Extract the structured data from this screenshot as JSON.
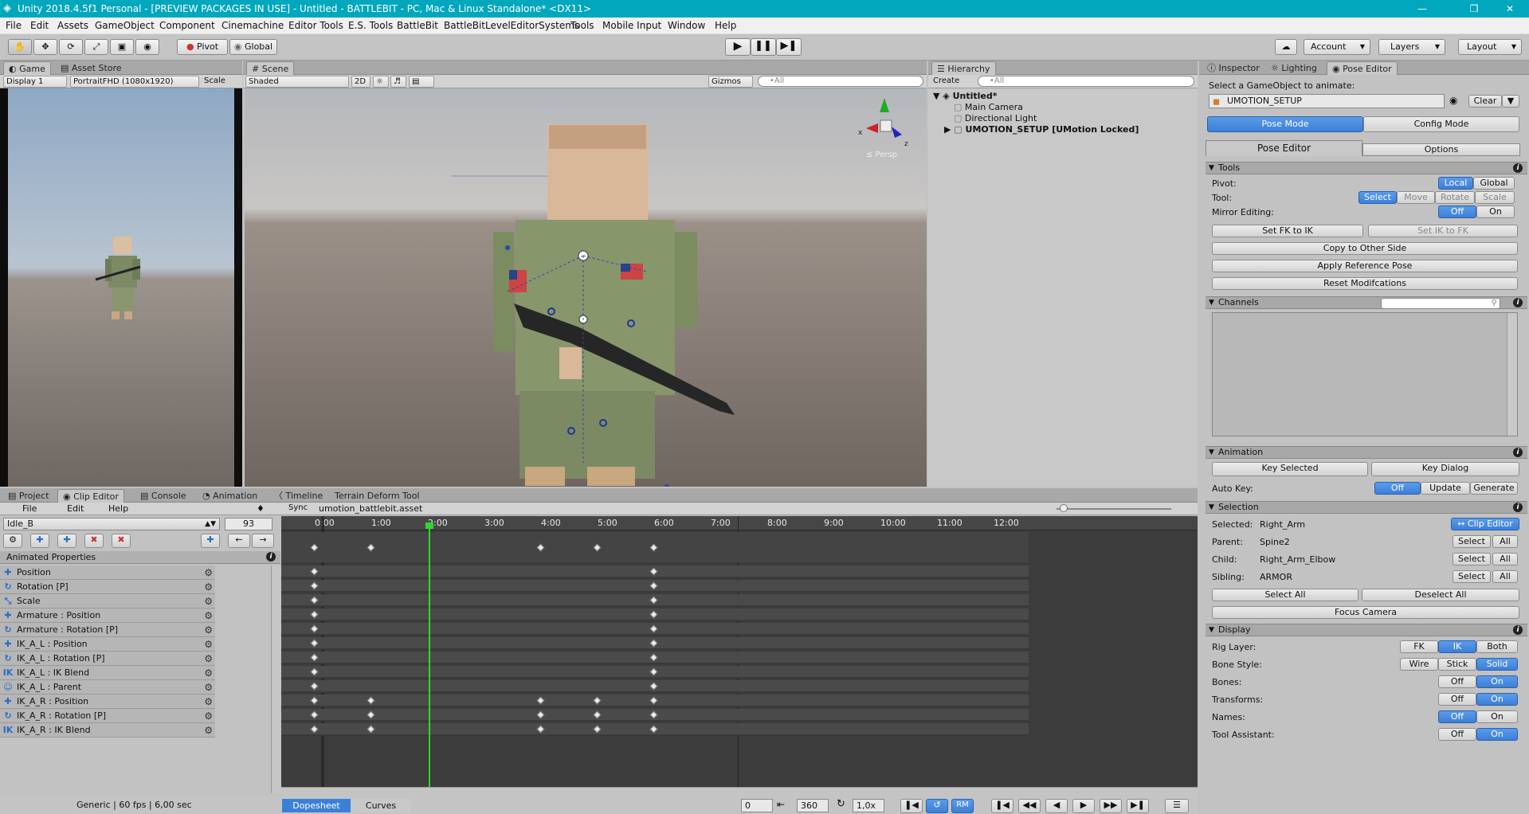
{
  "window": {
    "title": "Unity 2018.4.5f1 Personal - [PREVIEW PACKAGES IN USE] - Untitled - BATTLEBIT - PC, Mac & Linux Standalone* <DX11>",
    "controls": [
      "—",
      "❐",
      "✕"
    ]
  },
  "menu": [
    "File",
    "Edit",
    "Assets",
    "GameObject",
    "Component",
    "Cinemachine",
    "Editor Tools",
    "E.S. Tools",
    "BattleBit",
    "BattleBitLevelEditorSystems",
    "Tools",
    "Mobile Input",
    "Window",
    "Help"
  ],
  "toolbar": {
    "pivot": "Pivot",
    "global": "Global",
    "account": "Account",
    "layers": "Layers",
    "layout": "Layout"
  },
  "game_panel": {
    "tabs": [
      "Game",
      "Asset Store"
    ],
    "display": "Display 1",
    "resolution": "PortraitFHD (1080x1920)",
    "scale": "Scale"
  },
  "scene_panel": {
    "tab": "Scene",
    "shading": "Shaded",
    "mode_2d": "2D",
    "gizmos": "Gizmos",
    "search_placeholder": "•All",
    "persp": "≤ Persp",
    "axis_x": "x",
    "axis_z": "z"
  },
  "hierarchy": {
    "tab": "Hierarchy",
    "create": "Create",
    "search_placeholder": "•All",
    "scene": "Untitled*",
    "items": [
      "Main Camera",
      "Directional Light",
      "UMOTION_SETUP [UMotion Locked]"
    ]
  },
  "inspector": {
    "tabs": [
      "Inspector",
      "Lighting",
      "Pose Editor"
    ],
    "select_label": "Select a GameObject to animate:",
    "object_field": "UMOTION_SETUP",
    "clear": "Clear",
    "pose_mode": "Pose Mode",
    "config_mode": "Config Mode",
    "subtabs": [
      "Pose Editor",
      "Options"
    ],
    "tools": {
      "header": "Tools",
      "pivot_label": "Pivot:",
      "pivot_opts": [
        "Local",
        "Global"
      ],
      "tool_label": "Tool:",
      "tool_opts": [
        "Select",
        "Move",
        "Rotate",
        "Scale"
      ],
      "mirror_label": "Mirror Editing:",
      "mirror_opts": [
        "Off",
        "On"
      ],
      "set_fk_ik": "Set FK to IK",
      "set_ik_fk": "Set IK to FK",
      "copy_other": "Copy to Other Side",
      "apply_ref": "Apply Reference Pose",
      "reset_mod": "Reset Modifcations"
    },
    "channels": {
      "header": "Channels"
    },
    "animation": {
      "header": "Animation",
      "key_selected": "Key Selected",
      "key_dialog": "Key Dialog",
      "auto_key": "Auto Key:",
      "auto_opts": [
        "Off",
        "Update",
        "Generate"
      ]
    },
    "selection": {
      "header": "Selection",
      "selected_label": "Selected:",
      "selected_val": "Right_Arm",
      "clip_editor_btn": "↔ Clip Editor",
      "parent_label": "Parent:",
      "parent_val": "Spine2",
      "child_label": "Child:",
      "child_val": "Right_Arm_Elbow",
      "sibling_label": "Sibling:",
      "sibling_val": "ARMOR",
      "select": "Select",
      "all": "All",
      "select_all": "Select All",
      "deselect_all": "Deselect All",
      "focus_camera": "Focus Camera"
    },
    "display": {
      "header": "Display",
      "rig_label": "Rig Layer:",
      "rig_opts": [
        "FK",
        "IK",
        "Both"
      ],
      "bone_style_label": "Bone Style:",
      "bone_style_opts": [
        "Wire",
        "Stick",
        "Solid"
      ],
      "bones_label": "Bones:",
      "transforms_label": "Transforms:",
      "names_label": "Names:",
      "tool_assist_label": "Tool Assistant:",
      "off": "Off",
      "on": "On"
    }
  },
  "bottom_tabs": [
    "Project",
    "Clip Editor",
    "Console",
    "Animation",
    "Timeline",
    "Terrain Deform Tool"
  ],
  "clip_editor": {
    "menu": [
      "File",
      "Edit",
      "Help"
    ],
    "sync": "Sync",
    "asset": "umotion_battlebit.asset",
    "clip": "Idle_B",
    "frame": "93",
    "animated_props": "Animated Properties",
    "properties": [
      {
        "name": "Position",
        "icon": "✚"
      },
      {
        "name": "Rotation [P]",
        "icon": "↻"
      },
      {
        "name": "Scale",
        "icon": "⤡"
      },
      {
        "name": "Armature : Position",
        "icon": "✚"
      },
      {
        "name": "Armature : Rotation [P]",
        "icon": "↻"
      },
      {
        "name": "IK_A_L : Position",
        "icon": "✚"
      },
      {
        "name": "IK_A_L : Rotation [P]",
        "icon": "↻"
      },
      {
        "name": "IK_A_L : IK Blend",
        "icon": "IK"
      },
      {
        "name": "IK_A_L : Parent",
        "icon": "☺"
      },
      {
        "name": "IK_A_R : Position",
        "icon": "✚"
      },
      {
        "name": "IK_A_R : Rotation [P]",
        "icon": "↻"
      },
      {
        "name": "IK_A_R : IK Blend",
        "icon": "IK"
      }
    ],
    "timeline_ticks": [
      "0:00",
      "1:00",
      "2:00",
      "3:00",
      "4:00",
      "5:00",
      "6:00",
      "7:00",
      "8:00",
      "9:00",
      "10:00",
      "11:00",
      "12:00"
    ],
    "status": "Generic | 60 fps | 6,00 sec",
    "bottom_tabs": [
      "Dopesheet",
      "Curves"
    ],
    "start_frame": "0",
    "length": "360",
    "speed": "1,0x",
    "rm": "RM"
  }
}
